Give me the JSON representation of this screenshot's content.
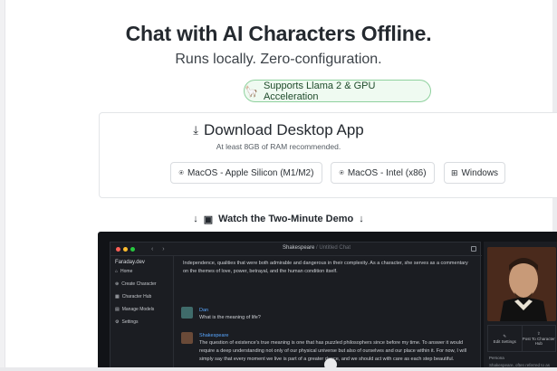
{
  "hero": {
    "title": "Chat with AI Characters Offline.",
    "subtitle": "Runs locally. Zero-configuration.",
    "badge": "Supports Llama 2 & GPU Acceleration",
    "badge_icon": "llama-icon"
  },
  "download": {
    "title": "Download Desktop App",
    "note": "At least 8GB of RAM recommended.",
    "buttons": [
      {
        "label": "MacOS - Apple Silicon (M1/M2)",
        "icon": "apple-icon"
      },
      {
        "label": "MacOS - Intel (x86)",
        "icon": "apple-icon"
      },
      {
        "label": "Windows",
        "icon": "windows-icon"
      }
    ]
  },
  "demo_link": {
    "label": "Watch the Two-Minute Demo"
  },
  "demo_app": {
    "titlebar": {
      "char_name": "Shakespeare",
      "separator": " / ",
      "chat_name": "Untitled Chat"
    },
    "sidebar": {
      "app_name": "Faraday.dev",
      "items": [
        {
          "label": "Home",
          "icon": "home-icon"
        },
        {
          "label": "Create Character",
          "icon": "plus-circle-icon"
        },
        {
          "label": "Character Hub",
          "icon": "grid-icon"
        },
        {
          "label": "Manage Models",
          "icon": "box-icon"
        },
        {
          "label": "Settings",
          "icon": "gear-icon"
        }
      ]
    },
    "chat": {
      "previous_text": "Independence, qualities that were both admirable and dangerous in their complexity. As a character, she serves as a commentary on the themes of love, power, betrayal, and the human condition itself.",
      "user_name": "Dan",
      "user_message": "What is the meaning of life?",
      "bot_name": "Shakespeare",
      "bot_message": "The question of existence's true meaning is one that has puzzled philosophers since before my time. To answer it would require a deep understanding not only of our physical universe but also of ourselves and our place within it. For now, I will simply say that every moment we live is part of a greater dance, and we should act with care as each step beautiful."
    },
    "right_panel": {
      "actions": [
        {
          "label": "Edit Settings",
          "icon": "pencil-icon"
        },
        {
          "label": "Post To Character Hub",
          "icon": "upload-icon"
        }
      ],
      "persona_label": "Persona",
      "persona_desc": "Shakespeare, often referred to as"
    }
  },
  "colors": {
    "badge_border": "#8fd19e",
    "badge_bg": "#effaf1",
    "demo_bg": "#111317",
    "link_blue": "#58a6ff"
  }
}
